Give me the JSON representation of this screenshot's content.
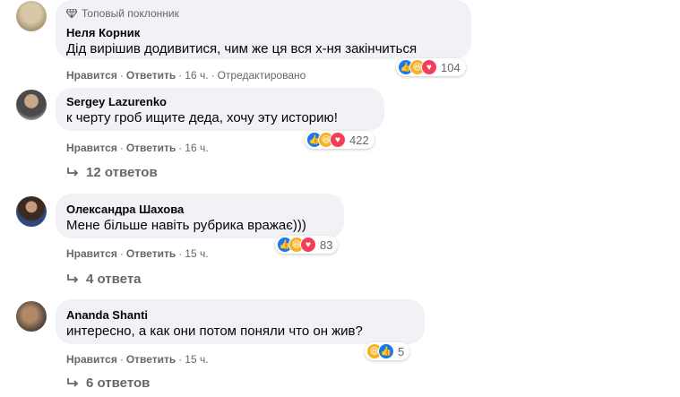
{
  "comments": [
    {
      "badge": "Топовый поклонник",
      "author": "Неля Корник",
      "text": "Дід вирішив додивитися, чим же ця вся х-ня закінчиться",
      "like": "Нравится",
      "reply": "Ответить",
      "time": "16 ч.",
      "edited": "Отредактировано",
      "reaction_count": "104",
      "reactions": [
        "like-icon",
        "haha-icon",
        "love-icon"
      ],
      "replies": ""
    },
    {
      "author": "Sergey Lazurenko",
      "text": "к черту гроб ищите деда, хочу эту историю!",
      "like": "Нравится",
      "reply": "Ответить",
      "time": "16 ч.",
      "reaction_count": "422",
      "reactions": [
        "like-icon",
        "haha-icon",
        "love-icon"
      ],
      "replies": "12 ответов"
    },
    {
      "author": "Олександра Шахова",
      "text": "Мене більше навіть рубрика вражає)))",
      "like": "Нравится",
      "reply": "Ответить",
      "time": "15 ч.",
      "reaction_count": "83",
      "reactions": [
        "like-icon",
        "haha-icon",
        "love-icon"
      ],
      "replies": "4 ответа"
    },
    {
      "author": "Ananda Shanti",
      "text": "интересно, а как они потом поняли что он жив?",
      "like": "Нравится",
      "reply": "Ответить",
      "time": "15 ч.",
      "reaction_count": "5",
      "reactions": [
        "haha-icon",
        "like-icon"
      ],
      "replies": "6 ответов"
    }
  ],
  "colors": {
    "bubble": "#f0f2f5",
    "meta_text": "#65676b",
    "like": "#1877f2",
    "haha": "#f7b125",
    "love": "#f33e58"
  }
}
